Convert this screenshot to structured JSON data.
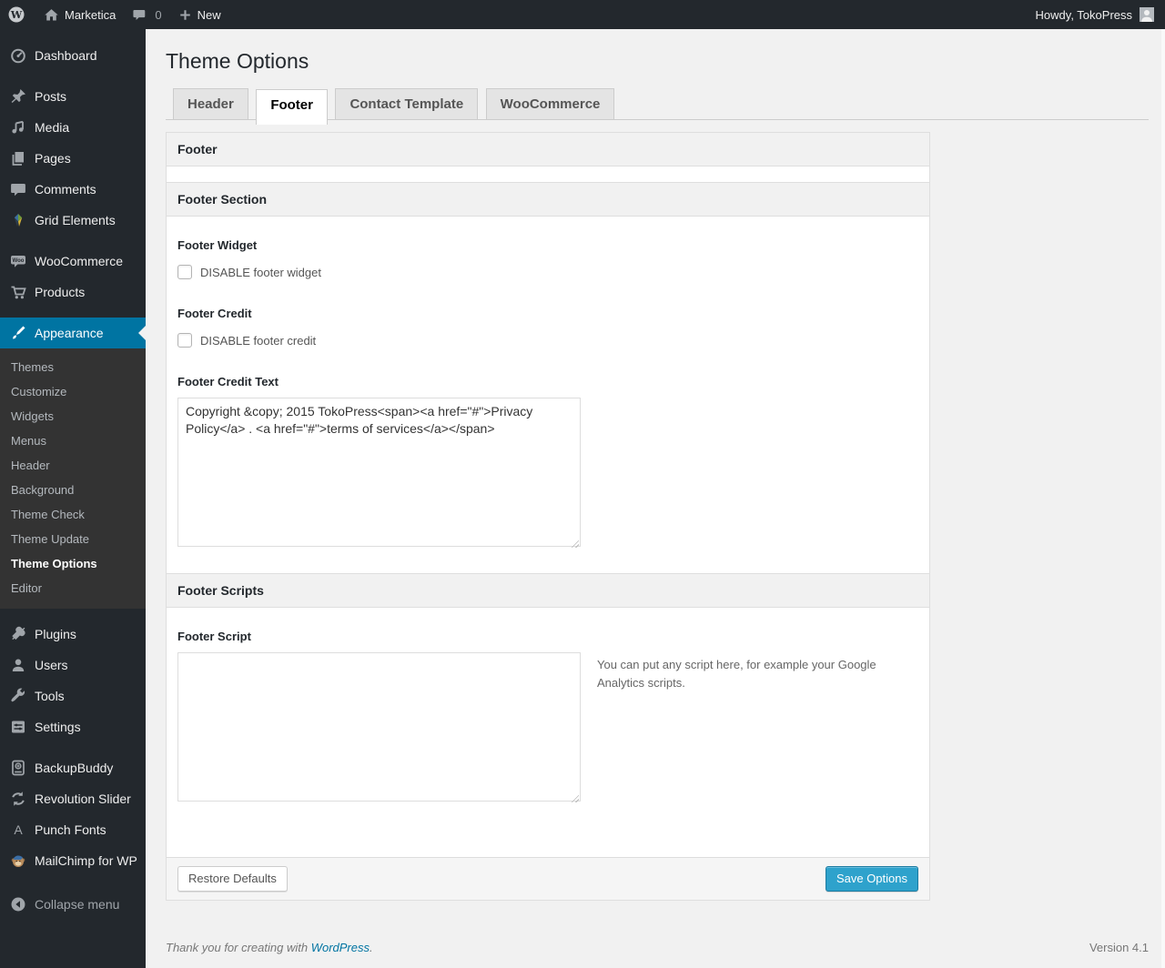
{
  "colors": {
    "accent": "#0074a2",
    "primary_button": "#2ea2cc",
    "menu_bg": "#23282d",
    "content_bg": "#f1f1f1"
  },
  "admin_bar": {
    "site_name": "Marketica",
    "comment_count": "0",
    "new_label": "New",
    "howdy": "Howdy, TokoPress"
  },
  "sidebar": {
    "items": [
      {
        "label": "Dashboard",
        "icon": "dashboard-icon"
      },
      {
        "label": "Posts",
        "icon": "pushpin-icon"
      },
      {
        "label": "Media",
        "icon": "media-icon"
      },
      {
        "label": "Pages",
        "icon": "pages-icon"
      },
      {
        "label": "Comments",
        "icon": "comments-icon"
      },
      {
        "label": "Grid Elements",
        "icon": "grid-elements-icon"
      },
      {
        "label": "WooCommerce",
        "icon": "woocommerce-icon"
      },
      {
        "label": "Products",
        "icon": "cart-icon"
      },
      {
        "label": "Appearance",
        "icon": "paintbrush-icon",
        "active": true
      }
    ],
    "appearance_submenu": [
      "Themes",
      "Customize",
      "Widgets",
      "Menus",
      "Header",
      "Background",
      "Theme Check",
      "Theme Update",
      "Theme Options",
      "Editor"
    ],
    "current_submenu_item": "Theme Options",
    "lower_items": [
      {
        "label": "Plugins",
        "icon": "plug-icon"
      },
      {
        "label": "Users",
        "icon": "user-icon"
      },
      {
        "label": "Tools",
        "icon": "wrench-icon"
      },
      {
        "label": "Settings",
        "icon": "sliders-icon"
      },
      {
        "label": "BackupBuddy",
        "icon": "backup-icon"
      },
      {
        "label": "Revolution Slider",
        "icon": "refresh-icon"
      },
      {
        "label": "Punch Fonts",
        "icon": "letter-a-icon"
      },
      {
        "label": "MailChimp for WP",
        "icon": "monkey-icon"
      }
    ],
    "collapse_label": "Collapse menu"
  },
  "page": {
    "title": "Theme Options",
    "tabs": [
      {
        "label": "Header",
        "active": false
      },
      {
        "label": "Footer",
        "active": true
      },
      {
        "label": "Contact Template",
        "active": false
      },
      {
        "label": "WooCommerce",
        "active": false
      }
    ]
  },
  "panel": {
    "header_title": "Footer",
    "section_title": "Footer Section",
    "footer_widget": {
      "label": "Footer Widget",
      "checkbox_label": "DISABLE footer widget",
      "checked": false
    },
    "footer_credit": {
      "label": "Footer Credit",
      "checkbox_label": "DISABLE footer credit",
      "checked": false
    },
    "footer_credit_text": {
      "label": "Footer Credit Text",
      "value": "Copyright &copy; 2015 TokoPress<span><a href=\"#\">Privacy Policy</a> . <a href=\"#\">terms of services</a></span>"
    },
    "footer_scripts_title": "Footer Scripts",
    "footer_script": {
      "label": "Footer Script",
      "value": "",
      "description": "You can put any script here, for example your Google Analytics scripts."
    }
  },
  "actions": {
    "restore_label": "Restore Defaults",
    "save_label": "Save Options"
  },
  "page_footer": {
    "thanks_text": "Thank you for creating with ",
    "wordpress_link": "WordPress",
    "period": ".",
    "version": "Version 4.1"
  }
}
